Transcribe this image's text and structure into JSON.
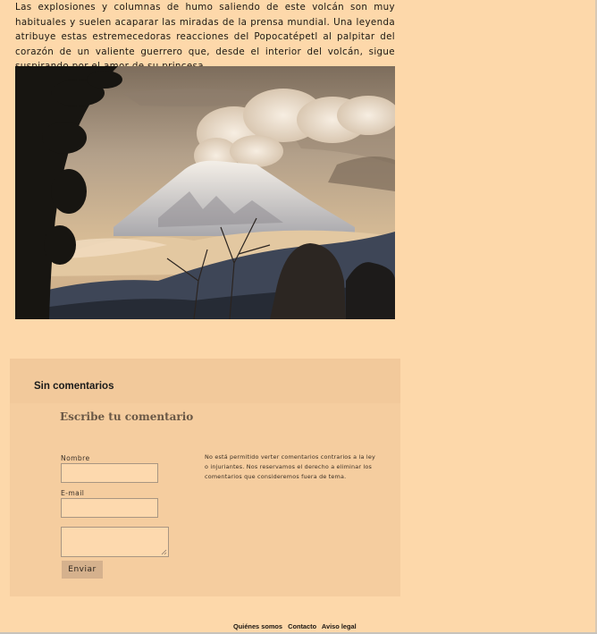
{
  "article": {
    "paragraph": "Las explosiones y columnas de humo saliendo de este volcán son muy habituales y suelen acaparar las miradas de la prensa mundial. Una leyenda atribuye estas estremecedoras reacciones del Popocatépetl al palpitar del corazón de un valiente guerrero que, desde el interior del volcán, sigue suspirando por el amor de su princesa."
  },
  "comments": {
    "title": "Sin comentarios",
    "form": {
      "title": "Escribe tu comentario",
      "name_label": "Nombre",
      "name_value": "",
      "email_label": "E-mail",
      "email_value": "",
      "comment_value": "",
      "submit_label": "Enviar",
      "notice": "No está permitido verter comentarios contrarios a la ley o injuriantes. Nos reservamos el derecho a eliminar los comentarios que consideremos fuera de tema."
    }
  },
  "footer": {
    "links": [
      "Quiénes somos",
      "Contacto",
      "Aviso legal"
    ]
  },
  "colors": {
    "page_background": "#fdd8aa",
    "comments_background": "#f5cd9f",
    "button_background": "#d5b18d"
  }
}
